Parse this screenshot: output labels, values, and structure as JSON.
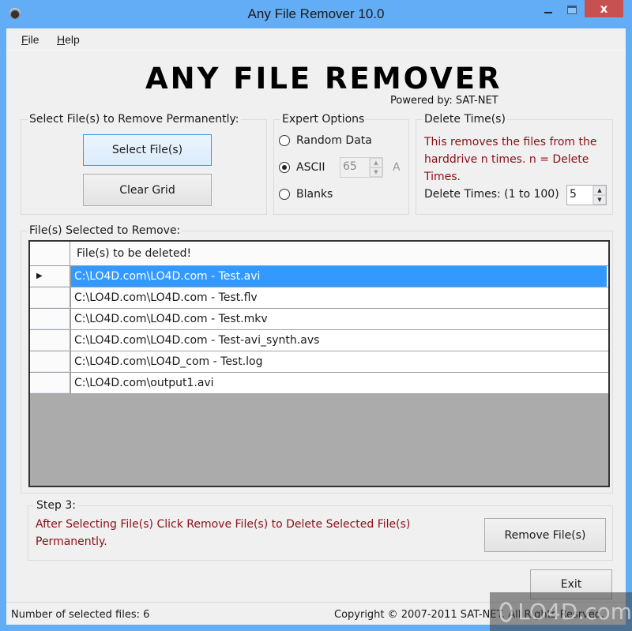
{
  "window": {
    "title": "Any File Remover 10.0",
    "icon": "app-icon",
    "controls": {
      "minimize": "minimize-icon",
      "maximize": "maximize-icon",
      "close_label": "x"
    }
  },
  "menu": {
    "items": [
      {
        "label_underlined": "F",
        "label_rest": "ile"
      },
      {
        "label_underlined": "H",
        "label_rest": "elp"
      }
    ]
  },
  "banner": {
    "logo": "ANY FILE REMOVER",
    "powered_by": "Powered by: SAT-NET"
  },
  "select_group": {
    "legend": "Select File(s) to Remove Permanently:",
    "select_button": "Select File(s)",
    "clear_button": "Clear Grid"
  },
  "expert_group": {
    "legend": "Expert Options",
    "options": [
      {
        "label": "Random Data",
        "checked": false
      },
      {
        "label": "ASCII",
        "checked": true
      },
      {
        "label": "Blanks",
        "checked": false
      }
    ],
    "ascii_value": "65",
    "ascii_char": "A"
  },
  "delete_group": {
    "legend": "Delete Time(s)",
    "description": "This removes the files from the harddrive n times. n = Delete Times.",
    "times_label": "Delete Times: (1 to 100)",
    "times_value": "5"
  },
  "files_group": {
    "legend": "File(s) Selected to Remove:",
    "column_header": "File(s) to be deleted!",
    "rows": [
      {
        "path": "C:\\LO4D.com\\LO4D.com - Test.avi",
        "selected": true
      },
      {
        "path": "C:\\LO4D.com\\LO4D.com - Test.flv",
        "selected": false
      },
      {
        "path": "C:\\LO4D.com\\LO4D.com - Test.mkv",
        "selected": false
      },
      {
        "path": "C:\\LO4D.com\\LO4D.com - Test-avi_synth.avs",
        "selected": false
      },
      {
        "path": "C:\\LO4D.com\\LO4D_com - Test.log",
        "selected": false
      },
      {
        "path": "C:\\LO4D.com\\output1.avi",
        "selected": false
      }
    ],
    "current_row_marker": "▶"
  },
  "step3": {
    "legend": "Step 3:",
    "instructions": "After Selecting File(s) Click Remove File(s) to Delete Selected File(s) Permanently.",
    "remove_button": "Remove File(s)"
  },
  "exit_button": "Exit",
  "status": {
    "selected_count_label": "Number of selected files:  6",
    "copyright": "Copyright © 2007-2011 SAT-NET. All Rights Resrved."
  },
  "watermark": "LO4D.com",
  "colors": {
    "title_bar": "#62adf5",
    "close_button": "#c75050",
    "selection": "#3399ff",
    "warning_text": "#8b0f17",
    "grid_empty": "#ababab"
  }
}
